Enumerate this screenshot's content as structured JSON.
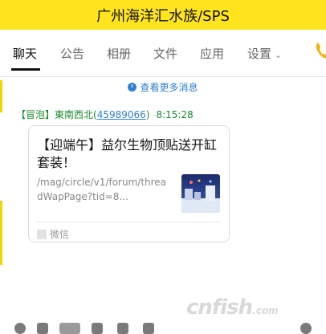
{
  "window": {
    "title": "广州海洋汇水族/SPS"
  },
  "tabs": [
    {
      "label": "聊天",
      "active": true
    },
    {
      "label": "公告",
      "active": false
    },
    {
      "label": "相册",
      "active": false
    },
    {
      "label": "文件",
      "active": false
    },
    {
      "label": "应用",
      "active": false
    },
    {
      "label": "设置",
      "active": false
    }
  ],
  "history_link": "查看更多消息",
  "message": {
    "sender_badge": "【冒泡】",
    "sender_name": "東南西北",
    "qq_open": "(",
    "qq_number": "45989066",
    "qq_close": ")",
    "time": "8:15:28",
    "card": {
      "title": "【迎端午】益尔生物顶贴送开缸套装！",
      "description": "/mag/circle/v1/forum/threadWapPage?tid=8...",
      "source": "微信"
    }
  },
  "watermark": {
    "text": "cnfish",
    "suffix": ".com"
  },
  "colors": {
    "title_bar": "#ffe41e",
    "link": "#2f7fd3",
    "sender": "#1a8a2e"
  }
}
